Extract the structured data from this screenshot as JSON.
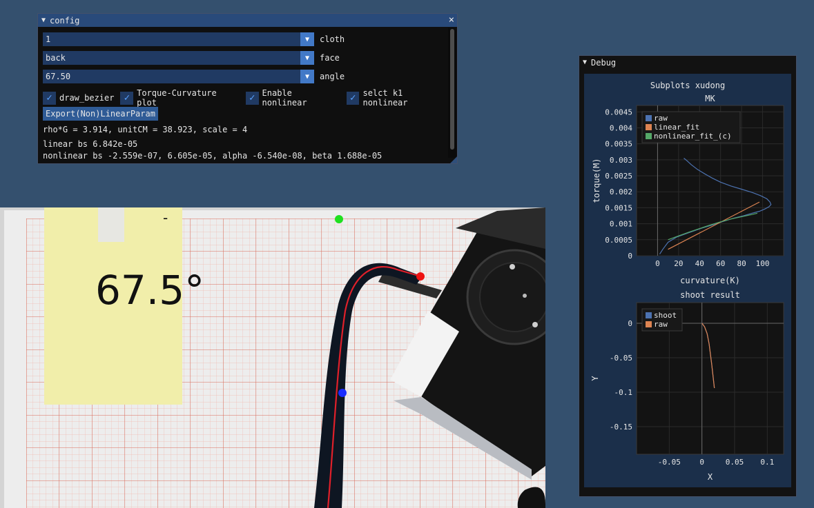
{
  "config": {
    "title": "config",
    "close_glyph": "×",
    "collapse_glyph": "▼",
    "combo_arrow": "▼",
    "cloth": {
      "value": "1",
      "label": "cloth"
    },
    "face": {
      "value": "back",
      "label": "face"
    },
    "angle": {
      "value": "67.50",
      "label": "angle"
    },
    "checkboxes": [
      {
        "label": "draw_bezier",
        "checked": true
      },
      {
        "label": "Torque-Curvature plot",
        "checked": true
      },
      {
        "label": "Enable nonlinear",
        "checked": true
      },
      {
        "label": "selct k1 nonlinear",
        "checked": true
      }
    ],
    "check_glyph": "✓",
    "export_button": "Export(Non)LinearParam",
    "info_line": "rho*G = 3.914, unitCM = 38.923, scale = 4",
    "linear_line": "linear bs 6.842e-05",
    "nonlinear_line": "nonlinear bs -2.559e-07, 6.605e-05, alpha -6.540e-08, beta 1.688e-05"
  },
  "photo": {
    "note_text": "67.5°",
    "note_dash": "-"
  },
  "debug": {
    "title": "Debug",
    "collapse_glyph": "▼",
    "subplots_title": "Subplots xudong"
  },
  "chart_data": [
    {
      "type": "line",
      "title": "MK",
      "xlabel": "curvature(K)",
      "ylabel": "torque(M)",
      "xlim": [
        -20,
        120
      ],
      "ylim": [
        0,
        0.0047
      ],
      "xticks": [
        0,
        20,
        40,
        60,
        80,
        100
      ],
      "yticks": [
        0,
        0.0005,
        0.001,
        0.0015,
        0.002,
        0.0025,
        0.003,
        0.0035,
        0.004,
        0.0045
      ],
      "ytick_labels": [
        "0",
        "0.0005",
        "0.001",
        "0.0015",
        "0.002",
        "0.0025",
        "0.003",
        "0.0035",
        "0.004",
        "0.0045"
      ],
      "legend_position": "top-left",
      "grid": true,
      "series": [
        {
          "name": "raw",
          "color": "#4c72b0",
          "x": [
            2,
            5,
            10,
            18,
            28,
            40,
            52,
            62,
            72,
            82,
            90,
            97,
            102,
            106,
            108,
            107,
            104,
            98,
            90,
            80,
            70,
            60,
            52,
            45,
            38,
            32,
            28,
            25
          ],
          "y": [
            5e-05,
            0.0002,
            0.00042,
            0.00058,
            0.0007,
            0.00084,
            0.00096,
            0.00107,
            0.00117,
            0.00125,
            0.00133,
            0.00139,
            0.00146,
            0.00153,
            0.0016,
            0.00168,
            0.00178,
            0.00188,
            0.00198,
            0.00208,
            0.00218,
            0.0023,
            0.00243,
            0.00256,
            0.0027,
            0.00285,
            0.00297,
            0.00305
          ]
        },
        {
          "name": "linear_fit",
          "color": "#dd8452",
          "x": [
            10,
            97
          ],
          "y": [
            0.0002,
            0.00168
          ]
        },
        {
          "name": "nonlinear_fit_(c)",
          "color": "#55a868",
          "x": [
            10,
            20,
            30,
            40,
            50,
            60,
            70,
            80,
            90,
            95
          ],
          "y": [
            0.0005,
            0.00062,
            0.00074,
            0.00085,
            0.00096,
            0.00106,
            0.00115,
            0.00122,
            0.00129,
            0.00133
          ]
        }
      ]
    },
    {
      "type": "line",
      "title": "shoot result",
      "xlabel": "X",
      "ylabel": "Y",
      "xlim": [
        -0.1,
        0.125
      ],
      "ylim": [
        -0.19,
        0.03
      ],
      "xticks": [
        -0.05,
        0,
        0.05,
        0.1
      ],
      "xtick_labels": [
        "-0.05",
        "0",
        "0.05",
        "0.1"
      ],
      "yticks": [
        0,
        -0.05,
        -0.1,
        -0.15
      ],
      "ytick_labels": [
        "0",
        "-0.05",
        "-0.1",
        "-0.15"
      ],
      "legend_position": "top-left",
      "grid": true,
      "series": [
        {
          "name": "shoot",
          "color": "#4c72b0",
          "x": [
            0,
            0.004,
            0.008,
            0.011,
            0.013,
            0.015,
            0.017,
            0.019
          ],
          "y": [
            0,
            -0.005,
            -0.015,
            -0.03,
            -0.045,
            -0.06,
            -0.077,
            -0.094
          ]
        },
        {
          "name": "raw",
          "color": "#dd8452",
          "x": [
            0,
            0.004,
            0.008,
            0.011,
            0.013,
            0.015,
            0.017,
            0.019
          ],
          "y": [
            0,
            -0.005,
            -0.015,
            -0.03,
            -0.045,
            -0.06,
            -0.077,
            -0.094
          ]
        }
      ]
    }
  ]
}
